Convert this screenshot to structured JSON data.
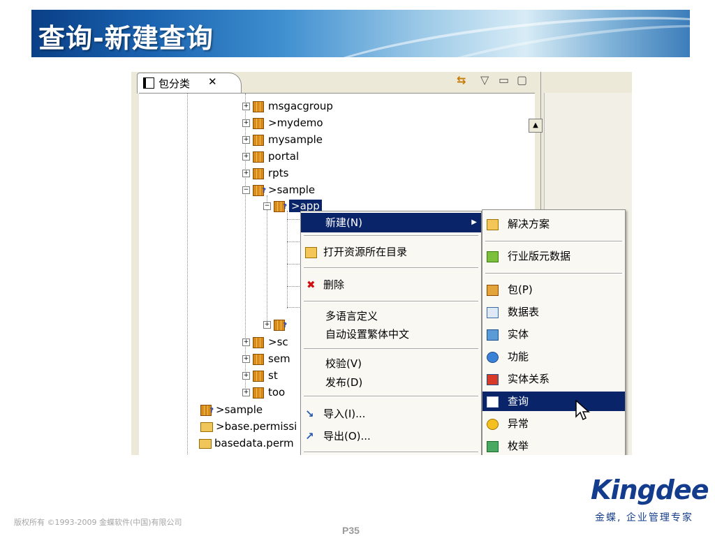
{
  "slide": {
    "title": "查询-新建查询",
    "copyright": "版权所有 ©1993-2009 金蝶软件(中国)有限公司",
    "page_number": "P35",
    "logo_text": "Kingdee",
    "slogan": "金蝶, 企业管理专家"
  },
  "view": {
    "tab_label": "包分类",
    "tab_close": "✕",
    "sync_icon": "⇆",
    "view_menu_icon": "▽",
    "minimize_icon": "▭",
    "maximize_icon": "▢",
    "scroll_up": "▲"
  },
  "tree": {
    "rows": [
      {
        "label": "msgacgroup"
      },
      {
        "label": ">mydemo"
      },
      {
        "label": "mysample"
      },
      {
        "label": "portal"
      },
      {
        "label": "rpts"
      },
      {
        "label": ">sample"
      },
      {
        "label": ">app"
      },
      {
        "label": ">sc"
      },
      {
        "label": "sem"
      },
      {
        "label": "st"
      },
      {
        "label": "too"
      },
      {
        "label": ">sample"
      },
      {
        "label": ">base.permissi"
      },
      {
        "label": "basedata.perm"
      }
    ]
  },
  "context_menu": {
    "items": [
      {
        "label": "新建(N)"
      },
      {
        "label": "打开资源所在目录"
      },
      {
        "label": "删除"
      },
      {
        "label": "多语言定义"
      },
      {
        "label": "自动设置繁体中文"
      },
      {
        "label": "校验(V)"
      },
      {
        "label": "发布(D)"
      },
      {
        "label": "导入(I)..."
      },
      {
        "label": "导出(O)..."
      }
    ]
  },
  "submenu": {
    "items": [
      {
        "label": "解决方案"
      },
      {
        "label": "行业版元数据"
      },
      {
        "label": "包(P)"
      },
      {
        "label": "数据表"
      },
      {
        "label": "实体"
      },
      {
        "label": "功能"
      },
      {
        "label": "实体关系"
      },
      {
        "label": "查询"
      },
      {
        "label": "异常"
      },
      {
        "label": "枚举"
      }
    ]
  },
  "colors": {
    "selection": "#0a246a",
    "brand_blue": "#143c8c"
  }
}
